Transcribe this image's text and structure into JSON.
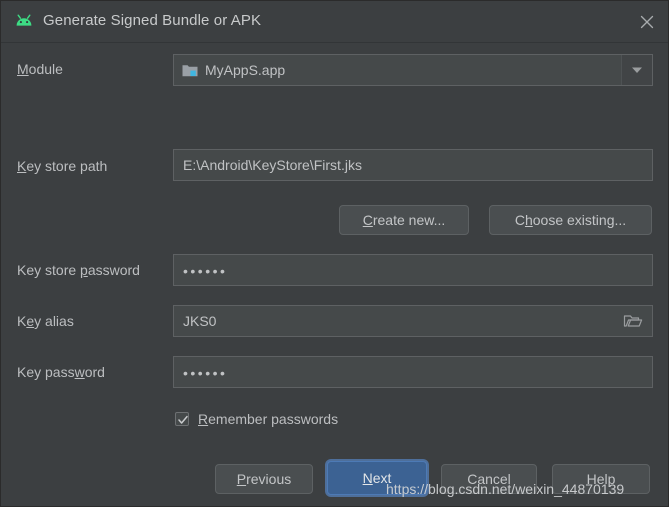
{
  "window": {
    "title": "Generate Signed Bundle or APK",
    "app_icon": "android-robot-icon",
    "close_icon": "close-icon",
    "accent_color": "#3c6293",
    "background_color": "#3c3f41",
    "field_color": "#45494a",
    "android_green": "#3ddc84"
  },
  "form": {
    "module": {
      "label": "Module",
      "label_mnemonic": "M",
      "label_rest": "odule",
      "value": "MyAppS.app",
      "icon": "module-folder-icon",
      "dropdown_icon": "chevron-down-icon"
    },
    "key_store_path": {
      "label_mnemonic": "K",
      "label_rest": "ey store path",
      "value": "E:\\Android\\KeyStore\\First.jks",
      "placeholder": ""
    },
    "create_new_button": {
      "prefix": "",
      "mnemonic": "C",
      "rest": "reate new..."
    },
    "choose_existing_button": {
      "prefix": "C",
      "mnemonic": "h",
      "rest": "oose existing..."
    },
    "key_store_password": {
      "label_prefix": "Key store ",
      "label_mnemonic": "p",
      "label_rest": "assword",
      "value": "••••••",
      "masked": true
    },
    "key_alias": {
      "label_prefix": "K",
      "label_mnemonic": "e",
      "label_rest": "y alias",
      "value": "JKS0",
      "browse_icon": "folder-open-icon"
    },
    "key_password": {
      "label_prefix": "Key pass",
      "label_mnemonic": "w",
      "label_rest": "ord",
      "value": "••••••",
      "masked": true
    },
    "remember_passwords": {
      "label_mnemonic": "R",
      "label_rest": "emember passwords",
      "checked": true
    }
  },
  "footer": {
    "previous_button": {
      "mnemonic": "P",
      "rest": "revious"
    },
    "next_button": {
      "mnemonic": "N",
      "rest": "ext",
      "is_default": true
    },
    "cancel_button": {
      "prefix": "Cancel"
    },
    "help_button": {
      "prefix": "Help"
    }
  },
  "watermark": {
    "text": "https://blog.csdn.net/weixin_44870139"
  }
}
